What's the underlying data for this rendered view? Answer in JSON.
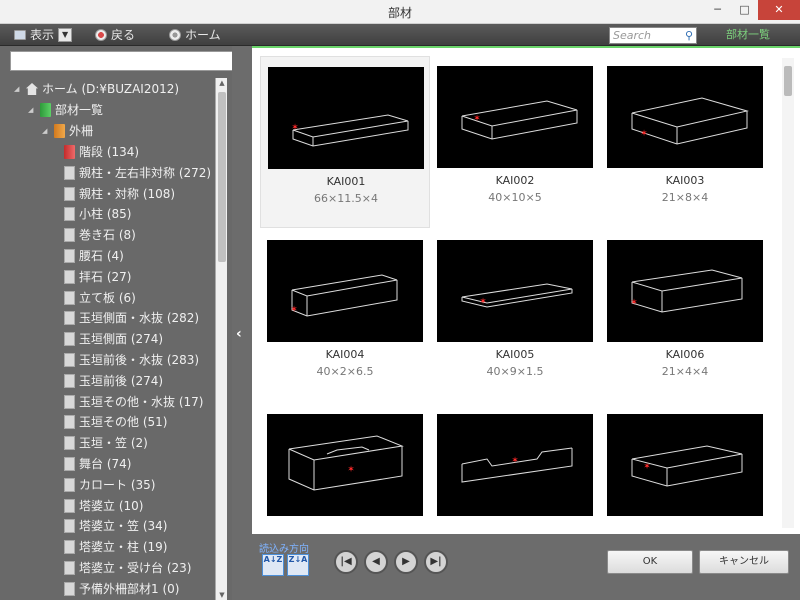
{
  "window": {
    "title": "部材",
    "minimize": "─",
    "maximize": "□",
    "close": "✕"
  },
  "toolbar": {
    "view_label": "表示",
    "view_dropdown": "▼",
    "back_label": "戻る",
    "home_label": "ホーム",
    "search_placeholder": "Search",
    "list_label": "部材一覧"
  },
  "tree": {
    "root": "ホーム (D:¥BUZAI2012)",
    "level1": "部材一覧",
    "level2": "外柵",
    "items": [
      "階段 (134)",
      "親柱・左右非対称 (272)",
      "親柱・対称 (108)",
      "小柱 (85)",
      "巻き石 (8)",
      "腰石 (4)",
      "拝石 (27)",
      "立て板 (6)",
      "玉垣側面・水抜 (282)",
      "玉垣側面 (274)",
      "玉垣前後・水抜 (283)",
      "玉垣前後 (274)",
      "玉垣その他・水抜 (17)",
      "玉垣その他 (51)",
      "玉垣・笠 (2)",
      "舞台 (74)",
      "カロート (35)",
      "塔婆立 (10)",
      "塔婆立・笠 (34)",
      "塔婆立・柱 (19)",
      "塔婆立・受け台 (23)",
      "予備外柵部材1 (0)"
    ]
  },
  "parts": [
    {
      "name": "KAI001",
      "dims": "66×11.5×4"
    },
    {
      "name": "KAI002",
      "dims": "40×10×5"
    },
    {
      "name": "KAI003",
      "dims": "21×8×4"
    },
    {
      "name": "KAI004",
      "dims": "40×2×6.5"
    },
    {
      "name": "KAI005",
      "dims": "40×9×1.5"
    },
    {
      "name": "KAI006",
      "dims": "21×4×4"
    },
    {
      "name": "",
      "dims": ""
    },
    {
      "name": "",
      "dims": ""
    },
    {
      "name": "",
      "dims": ""
    }
  ],
  "bottom": {
    "sort_label": "読込み方向",
    "sort_asc": "A↓Z",
    "sort_desc": "Z↓A",
    "first": "|◀",
    "prev": "◀",
    "next": "▶",
    "last": "▶|",
    "ok": "OK",
    "cancel": "キャンセル"
  },
  "colors": {
    "accent_green": "#6ad46a",
    "marker_red": "#ff2a2a",
    "panel_gray": "#696969"
  }
}
